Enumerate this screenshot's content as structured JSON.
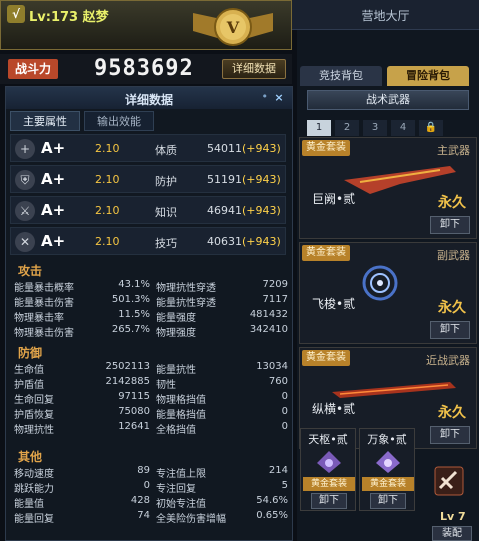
{
  "header": {
    "level_badge": "√",
    "level_text": "Lv:173 赵梦",
    "lobby_title": "营地大厅"
  },
  "power": {
    "label": "战斗力",
    "value": "9583692",
    "detail_button": "详细数据"
  },
  "panel": {
    "title": "详细数据",
    "close": "×",
    "pin": "•",
    "tabs": [
      "主要属性",
      "输出效能"
    ],
    "attributes": [
      {
        "icon": "plus-icon",
        "grade": "A+",
        "mult": "2.10",
        "name": "体质",
        "value": "54011",
        "bonus": "(+943)"
      },
      {
        "icon": "shield-icon",
        "grade": "A+",
        "mult": "2.10",
        "name": "防护",
        "value": "51191",
        "bonus": "(+943)"
      },
      {
        "icon": "swords-icon",
        "grade": "A+",
        "mult": "2.10",
        "name": "知识",
        "value": "46941",
        "bonus": "(+943)"
      },
      {
        "icon": "blade-icon",
        "grade": "A+",
        "mult": "2.10",
        "name": "技巧",
        "value": "40631",
        "bonus": "(+943)"
      }
    ],
    "sections": {
      "attack": "攻击",
      "defense": "防御",
      "other": "其他"
    },
    "attack_stats": [
      [
        "能量暴击概率",
        "43.1%",
        "物理抗性穿透",
        "7209"
      ],
      [
        "能量暴击伤害",
        "501.3%",
        "能量抗性穿透",
        "7117"
      ],
      [
        "物理暴击率",
        "11.5%",
        "能量强度",
        "481432"
      ],
      [
        "物理暴击伤害",
        "265.7%",
        "物理强度",
        "342410"
      ]
    ],
    "defense_stats": [
      [
        "生命值",
        "2502113",
        "能量抗性",
        "13034"
      ],
      [
        "护盾值",
        "2142885",
        "韧性",
        "760"
      ],
      [
        "生命回复",
        "97115",
        "物理格挡值",
        "0"
      ],
      [
        "护盾恢复",
        "75080",
        "能量格挡值",
        "0"
      ],
      [
        "物理抗性",
        "12641",
        "全格挡值",
        "0"
      ]
    ],
    "other_stats": [
      [
        "移动速度",
        "89",
        "专注值上限",
        "214"
      ],
      [
        "跳跃能力",
        "0",
        "专注回复",
        "5"
      ],
      [
        "能量值",
        "428",
        "初始专注值",
        "54.6%"
      ],
      [
        "能量回复",
        "74",
        "全美险伤害增幅",
        "0.65%"
      ]
    ]
  },
  "right": {
    "bag_tabs": [
      "竞技背包",
      "冒险背包"
    ],
    "tactics_button": "战术武器",
    "slot_tabs": [
      "1",
      "2",
      "3",
      "4",
      "🔒"
    ],
    "weapons": [
      {
        "type": "主武器",
        "gold": "黄金套装",
        "name": "巨阙•贰",
        "perm": "永久",
        "unload": "卸下"
      },
      {
        "type": "副武器",
        "gold": "黄金套装",
        "name": "飞梭•贰",
        "perm": "永久",
        "unload": "卸下"
      },
      {
        "type": "近战武器",
        "gold": "黄金套装",
        "name": "纵横•贰",
        "perm": "永久",
        "unload": "卸下"
      }
    ],
    "minis": [
      {
        "name": "天枢•贰",
        "gold": "黄金套装",
        "unload": "卸下"
      },
      {
        "name": "万象•贰",
        "gold": "黄金套装",
        "unload": "卸下"
      }
    ],
    "item_level": "Lv 7",
    "equip": "装配"
  }
}
